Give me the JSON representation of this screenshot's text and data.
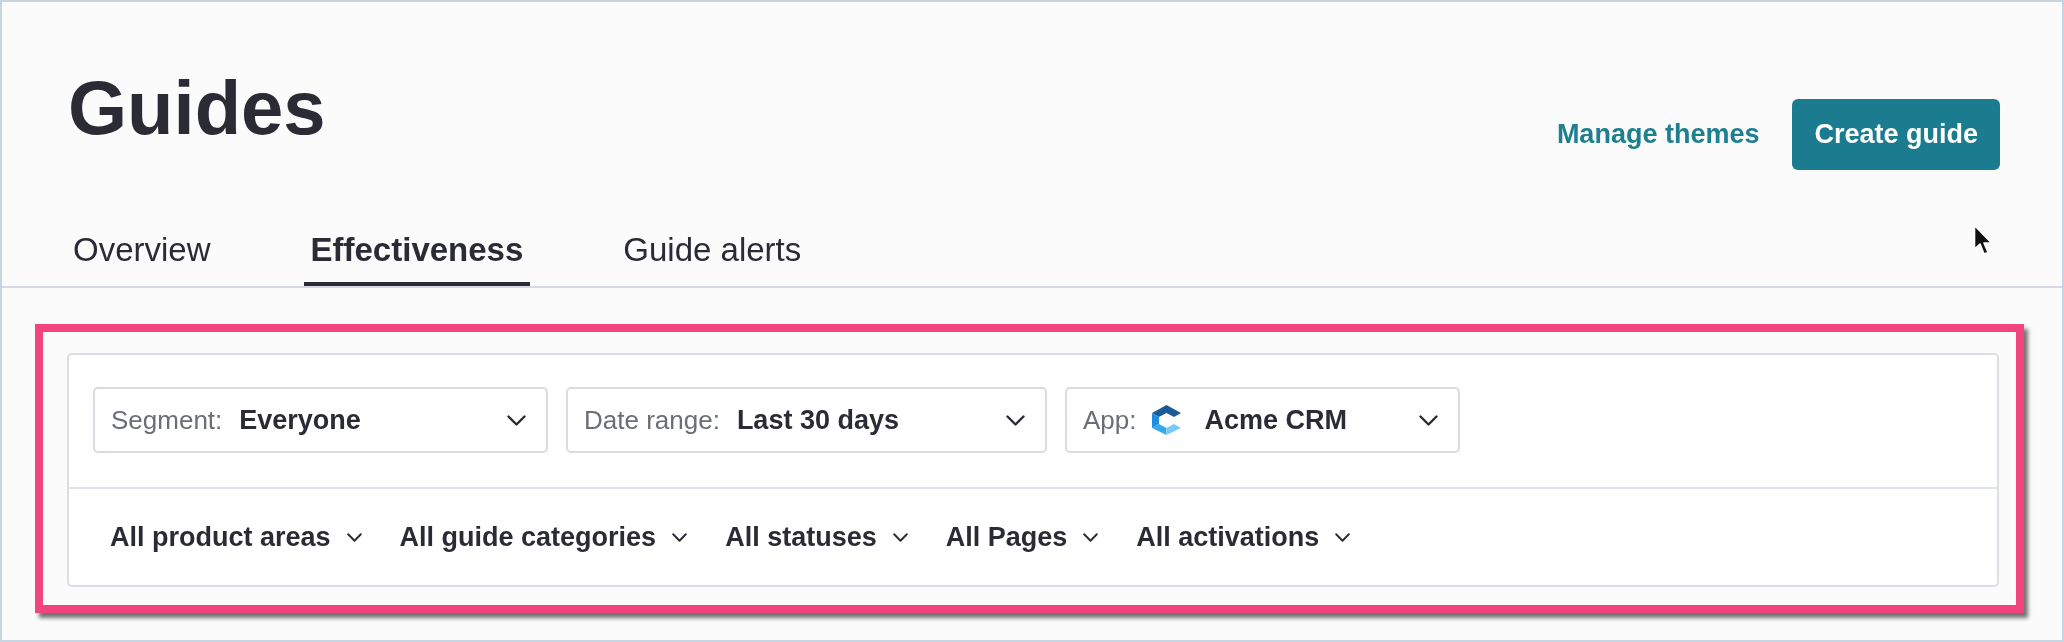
{
  "header": {
    "title": "Guides",
    "manage_link": "Manage themes",
    "create_button": "Create guide"
  },
  "tabs": [
    {
      "label": "Overview",
      "selected": false
    },
    {
      "label": "Effectiveness",
      "selected": true
    },
    {
      "label": "Guide alerts",
      "selected": false
    }
  ],
  "filters": [
    {
      "kind": "select",
      "label": "Segment:",
      "value": "Everyone"
    },
    {
      "kind": "select",
      "label": "Date range:",
      "value": "Last 30 days"
    },
    {
      "kind": "app",
      "label": "App:",
      "value": "Acme CRM"
    }
  ],
  "menus": [
    "All product areas",
    "All guide categories",
    "All statuses",
    "All Pages",
    "All activations"
  ]
}
